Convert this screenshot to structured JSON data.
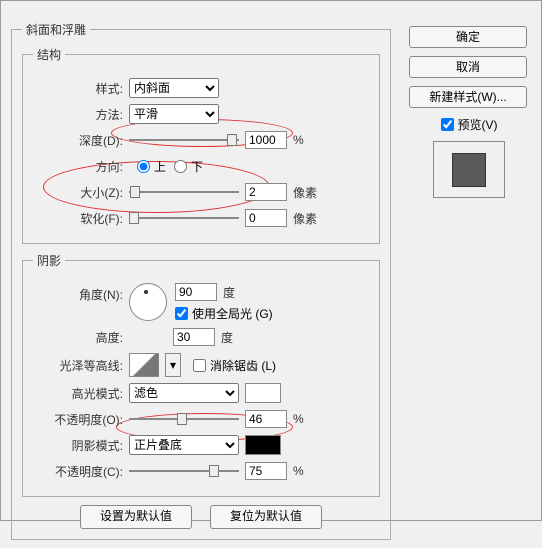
{
  "panel": {
    "outer_title": "斜面和浮雕",
    "structure": {
      "legend": "结构",
      "style_label": "样式:",
      "style_value": "内斜面",
      "method_label": "方法:",
      "method_value": "平滑",
      "depth_label": "深度(D):",
      "depth_value": "1000",
      "depth_unit": "%",
      "direction_label": "方向:",
      "dir_up": "上",
      "dir_down": "下",
      "size_label": "大小(Z):",
      "size_value": "2",
      "size_unit": "像素",
      "soften_label": "软化(F):",
      "soften_value": "0",
      "soften_unit": "像素"
    },
    "shading": {
      "legend": "阴影",
      "angle_label": "角度(N):",
      "angle_value": "90",
      "angle_unit": "度",
      "global_light": "使用全局光 (G)",
      "altitude_label": "高度:",
      "altitude_value": "30",
      "altitude_unit": "度",
      "gloss_label": "光泽等高线:",
      "antialias": "消除锯齿 (L)",
      "hl_mode_label": "高光模式:",
      "hl_mode_value": "滤色",
      "hl_opacity_label": "不透明度(O):",
      "hl_opacity_value": "46",
      "hl_opacity_unit": "%",
      "sh_mode_label": "阴影模式:",
      "sh_mode_value": "正片叠底",
      "sh_opacity_label": "不透明度(C):",
      "sh_opacity_value": "75",
      "sh_opacity_unit": "%"
    },
    "bottom": {
      "make_default": "设置为默认值",
      "reset_default": "复位为默认值"
    }
  },
  "sidebar": {
    "ok": "确定",
    "cancel": "取消",
    "new_style": "新建样式(W)...",
    "preview": "预览(V)"
  }
}
